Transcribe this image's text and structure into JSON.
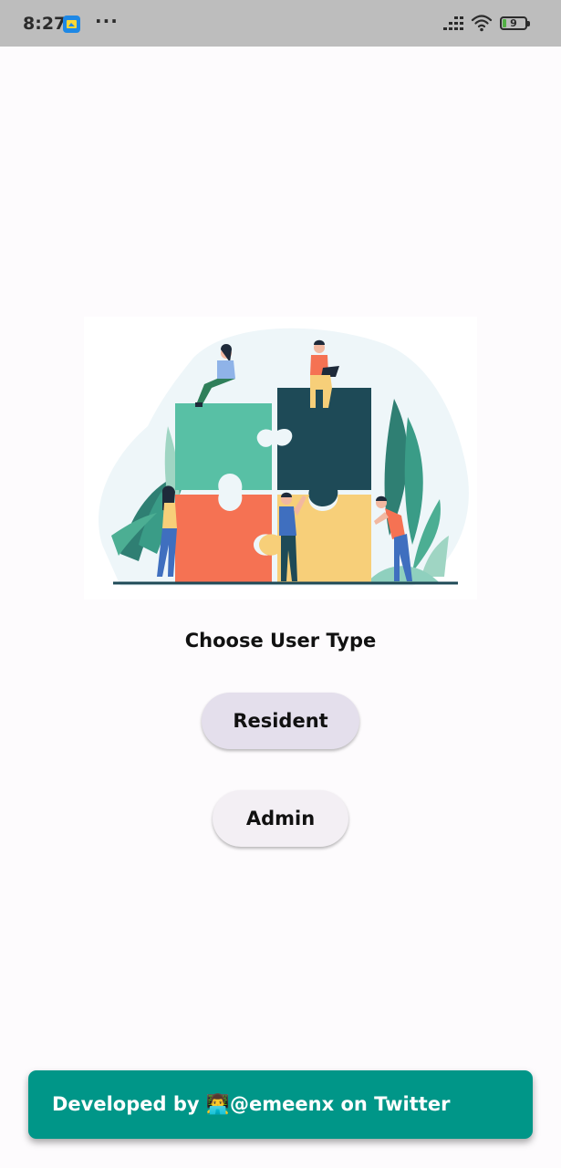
{
  "status_bar": {
    "time": "8:27",
    "more": "···",
    "battery_level": "9",
    "icons": [
      "app-icon",
      "signal-icon",
      "wifi-icon",
      "battery-icon"
    ]
  },
  "main": {
    "illustration": "puzzle-team-illustration",
    "heading": "Choose User Type",
    "buttons": {
      "resident": "Resident",
      "admin": "Admin"
    }
  },
  "snackbar": {
    "text": "Developed by 👨‍💻@emeenx on Twitter"
  },
  "colors": {
    "status_bar": "#bdbdbd",
    "background": "#fdfbfd",
    "resident_button": "#e4dfec",
    "admin_button": "#f3eff4",
    "snackbar": "#009688",
    "puzzle_teal": "#58c0a5",
    "puzzle_dark": "#1e4a57",
    "puzzle_orange": "#f57253",
    "puzzle_yellow": "#f7cf79"
  }
}
